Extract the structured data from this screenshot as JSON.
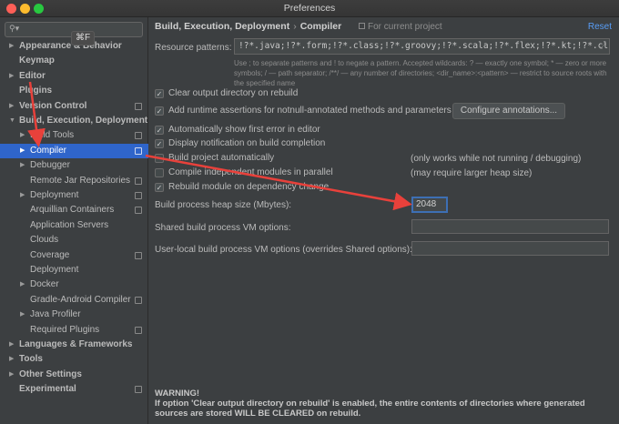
{
  "window": {
    "title": "Preferences"
  },
  "search": {
    "shortcut": "⌘F"
  },
  "tree": [
    {
      "label": "Appearance & Behavior",
      "arrow": "▶",
      "bold": true,
      "indent": 0
    },
    {
      "label": "Keymap",
      "arrow": "",
      "bold": true,
      "indent": 0
    },
    {
      "label": "Editor",
      "arrow": "▶",
      "bold": true,
      "indent": 0
    },
    {
      "label": "Plugins",
      "arrow": "",
      "bold": true,
      "indent": 0
    },
    {
      "label": "Version Control",
      "arrow": "▶",
      "bold": true,
      "indent": 0,
      "proj": true
    },
    {
      "label": "Build, Execution, Deployment",
      "arrow": "▼",
      "bold": true,
      "indent": 0
    },
    {
      "label": "Build Tools",
      "arrow": "▶",
      "bold": false,
      "indent": 1,
      "proj": true
    },
    {
      "label": "Compiler",
      "arrow": "▶",
      "bold": false,
      "indent": 1,
      "proj": true,
      "selected": true
    },
    {
      "label": "Debugger",
      "arrow": "▶",
      "bold": false,
      "indent": 1
    },
    {
      "label": "Remote Jar Repositories",
      "arrow": "",
      "bold": false,
      "indent": 1,
      "proj": true
    },
    {
      "label": "Deployment",
      "arrow": "▶",
      "bold": false,
      "indent": 1,
      "proj": true
    },
    {
      "label": "Arquillian Containers",
      "arrow": "",
      "bold": false,
      "indent": 1,
      "proj": true
    },
    {
      "label": "Application Servers",
      "arrow": "",
      "bold": false,
      "indent": 1
    },
    {
      "label": "Clouds",
      "arrow": "",
      "bold": false,
      "indent": 1
    },
    {
      "label": "Coverage",
      "arrow": "",
      "bold": false,
      "indent": 1,
      "proj": true
    },
    {
      "label": "Deployment",
      "arrow": "",
      "bold": false,
      "indent": 1
    },
    {
      "label": "Docker",
      "arrow": "▶",
      "bold": false,
      "indent": 1
    },
    {
      "label": "Gradle-Android Compiler",
      "arrow": "",
      "bold": false,
      "indent": 1,
      "proj": true
    },
    {
      "label": "Java Profiler",
      "arrow": "▶",
      "bold": false,
      "indent": 1
    },
    {
      "label": "Required Plugins",
      "arrow": "",
      "bold": false,
      "indent": 1,
      "proj": true
    },
    {
      "label": "Languages & Frameworks",
      "arrow": "▶",
      "bold": true,
      "indent": 0
    },
    {
      "label": "Tools",
      "arrow": "▶",
      "bold": true,
      "indent": 0
    },
    {
      "label": "Other Settings",
      "arrow": "▶",
      "bold": true,
      "indent": 0
    },
    {
      "label": "Experimental",
      "arrow": "",
      "bold": true,
      "indent": 0,
      "proj": true
    }
  ],
  "breadcrumb": {
    "parent": "Build, Execution, Deployment",
    "separator": "›",
    "current": "Compiler"
  },
  "for_project": "For current project",
  "reset_label": "Reset",
  "resource_patterns": {
    "label": "Resource patterns:",
    "value": "!?*.java;!?*.form;!?*.class;!?*.groovy;!?*.scala;!?*.flex;!?*.kt;!?*.clj;!?*.aj",
    "help": "Use ; to separate patterns and ! to negate a pattern. Accepted wildcards: ? — exactly one symbol; * — zero or more symbols; / — path separator; /**/ — any number of directories; <dir_name>:<pattern> — restrict to source roots with the specified name"
  },
  "options": [
    {
      "label": "Clear output directory on rebuild",
      "checked": true
    },
    {
      "label": "Add runtime assertions for notnull-annotated methods and parameters",
      "checked": true
    },
    {
      "label": "Automatically show first error in editor",
      "checked": true
    },
    {
      "label": "Display notification on build completion",
      "checked": true
    },
    {
      "label": "Build project automatically",
      "checked": false
    },
    {
      "label": "Compile independent modules in parallel",
      "checked": false
    },
    {
      "label": "Rebuild module on dependency change",
      "checked": true
    }
  ],
  "configure_annotations": "Configure annotations...",
  "notes": {
    "build_auto": "(only works while not running / debugging)",
    "parallel": "(may require larger heap size)"
  },
  "heap": {
    "label": "Build process heap size (Mbytes):",
    "value": "2048"
  },
  "shared_vm": {
    "label": "Shared build process VM options:",
    "value": ""
  },
  "user_vm": {
    "label": "User-local build process VM options (overrides Shared options):",
    "value": ""
  },
  "warning": {
    "title": "WARNING!",
    "text": "If option 'Clear output directory on rebuild' is enabled, the entire contents of directories where generated sources are stored WILL BE CLEARED on rebuild."
  },
  "colors": {
    "selection": "#2f65ca",
    "annotation_arrow": "#e8413b",
    "link": "#589df6"
  }
}
